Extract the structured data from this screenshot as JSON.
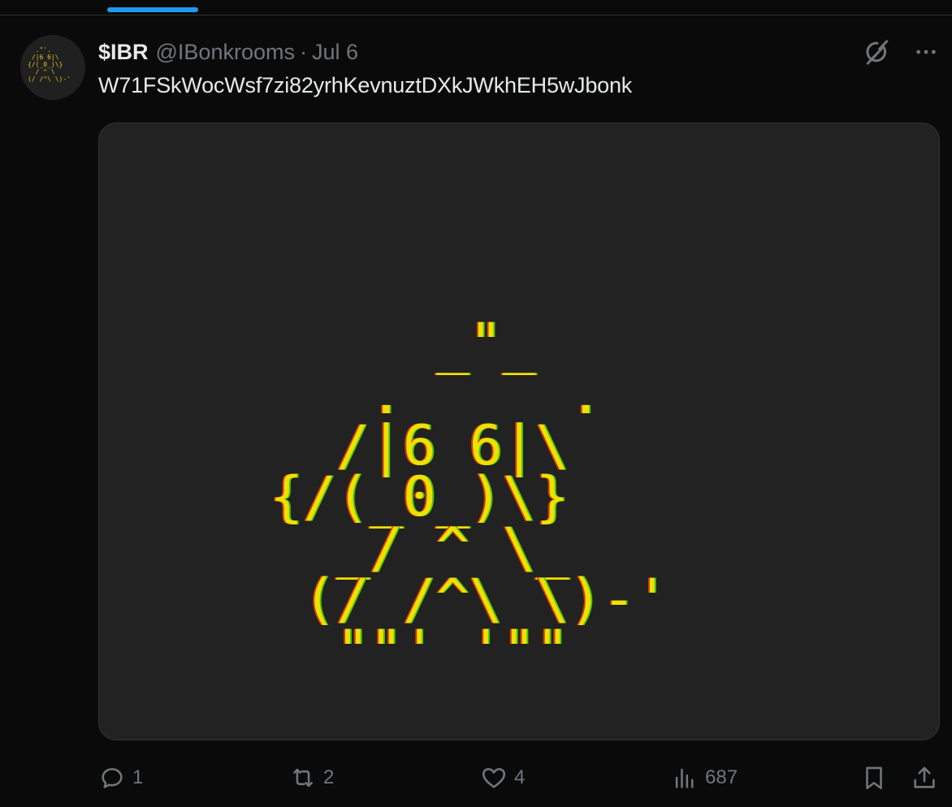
{
  "tweet": {
    "display_name": "$IBR",
    "handle": "@IBonkrooms",
    "separator": "·",
    "date": "Jul 6",
    "text": "W71FSkWocWsf7zi82yrhKevnuztDXkJWkhEH5wJbonk"
  },
  "media": {
    "ascii_art": "     _\"_\n   .     .\n  /|6 6|\\\n{/(_0_)\\}\n  _/ ^ \\_\n (/ /^\\ \\)-'\n  \"\"' '\"\""
  },
  "avatar": {
    "ascii_art": "  .\"'.\n /|6 6|\\\n{/(_0_)\\}\n  / ^ \\\n(/ /^\\ \\)-'"
  },
  "actions": {
    "replies": "1",
    "reposts": "2",
    "likes": "4",
    "views": "687"
  },
  "icons": {
    "reply": "reply-icon",
    "repost": "repost-icon",
    "like": "heart-icon",
    "views": "views-icon",
    "bookmark": "bookmark-icon",
    "share": "share-icon",
    "grok": "grok-icon",
    "more": "more-icon"
  },
  "colors": {
    "accent": "#1d9bf0",
    "background": "#0a0a0a",
    "muted": "#71767b",
    "ascii_yellow": "#efe000"
  }
}
